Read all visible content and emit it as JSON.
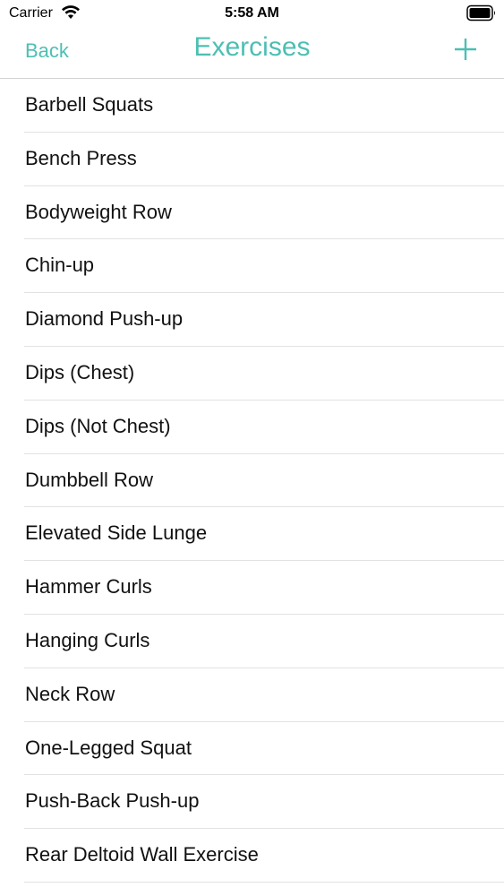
{
  "status": {
    "carrier": "Carrier",
    "time": "5:58 AM"
  },
  "nav": {
    "back_label": "Back",
    "title": "Exercises",
    "add_icon": "plus-icon"
  },
  "accent_color": "#4dbfb3",
  "exercises": [
    "Barbell Squats",
    "Bench Press",
    "Bodyweight Row",
    "Chin-up",
    "Diamond Push-up",
    "Dips (Chest)",
    "Dips (Not Chest)",
    "Dumbbell Row",
    "Elevated Side Lunge",
    "Hammer Curls",
    "Hanging Curls",
    "Neck Row",
    "One-Legged Squat",
    "Push-Back Push-up",
    "Rear Deltoid Wall Exercise"
  ]
}
